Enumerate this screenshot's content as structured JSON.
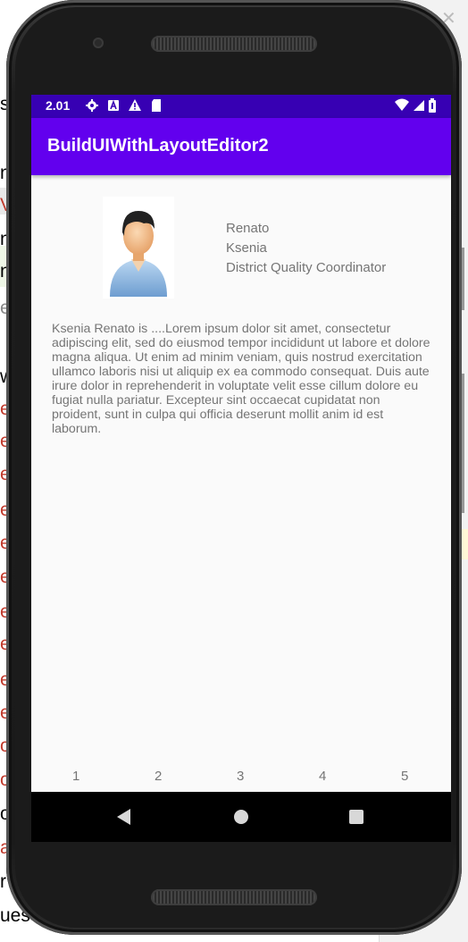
{
  "background_code": {
    "lines": [
      {
        "text": "s",
        "color": "#333333"
      },
      {
        "text": "n",
        "color": "#333333"
      },
      {
        "text": "V",
        "color": "#c0392b"
      },
      {
        "text": "n",
        "color": "#333333"
      },
      {
        "text": "n",
        "color": "#333333"
      },
      {
        "text": "e",
        "color": "#888888"
      },
      {
        "text": "w",
        "color": "#333333"
      },
      {
        "text": "e",
        "color": "#c0392b"
      },
      {
        "text": "e",
        "color": "#c0392b"
      },
      {
        "text": "e",
        "color": "#c0392b"
      },
      {
        "text": "e",
        "color": "#c0392b"
      },
      {
        "text": "e",
        "color": "#c0392b"
      },
      {
        "text": "e",
        "color": "#c0392b"
      },
      {
        "text": "e",
        "color": "#c0392b"
      },
      {
        "text": "e",
        "color": "#c0392b"
      },
      {
        "text": "e",
        "color": "#c0392b"
      },
      {
        "text": "e",
        "color": "#c0392b"
      },
      {
        "text": "o",
        "color": "#c0392b"
      },
      {
        "text": "o",
        "color": "#c0392b"
      },
      {
        "text": "o",
        "color": "#333333"
      },
      {
        "text": "a",
        "color": "#c0392b"
      },
      {
        "text": "r",
        "color": "#333333"
      },
      {
        "text": "ues",
        "color": "#333333"
      }
    ],
    "close_glyph": "✕"
  },
  "status_bar": {
    "time": "2.01",
    "left_icons": [
      "gear-icon",
      "a-badge-icon",
      "warning-icon",
      "sd-card-icon"
    ],
    "right_icons": [
      "wifi-icon",
      "cell-signal-icon",
      "battery-icon"
    ]
  },
  "app_bar": {
    "title": "BuildUIWithLayoutEditor2"
  },
  "profile": {
    "first_name": "Renato",
    "last_name": "Ksenia",
    "job_title": "District Quality Coordinator",
    "avatar_icon": "person-avatar-icon"
  },
  "description": "Ksenia Renato is ....Lorem ipsum dolor sit amet, consectetur adipiscing elit, sed do eiusmod tempor incididunt ut labore et dolore magna aliqua. Ut enim ad minim veniam, quis nostrud exercitation ullamco laboris nisi ut aliquip ex ea commodo consequat. Duis aute irure dolor in reprehenderit in voluptate velit esse cillum dolore eu fugiat nulla pariatur. Excepteur sint occaecat cupidatat non proident, sunt in culpa qui officia deserunt mollit anim id est laborum.",
  "pagination": [
    "1",
    "2",
    "3",
    "4",
    "5"
  ],
  "colors": {
    "status_bar": "#3700b3",
    "app_bar": "#6200ee",
    "body_text": "#757575"
  }
}
